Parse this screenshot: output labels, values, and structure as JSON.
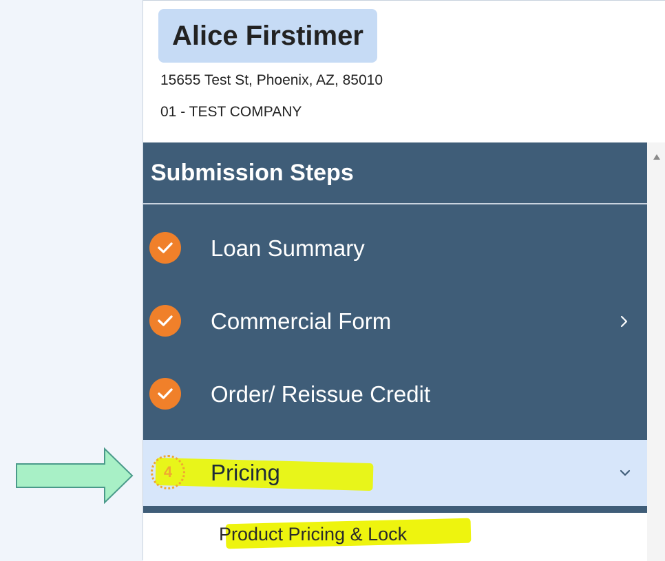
{
  "borrower": {
    "name": "Alice Firstimer",
    "address": "15655 Test St, Phoenix, AZ, 85010",
    "company": "01 - TEST COMPANY"
  },
  "nav": {
    "title": "Submission Steps",
    "steps": [
      {
        "label": "Loan Summary",
        "status": "complete"
      },
      {
        "label": "Commercial Form",
        "status": "complete"
      },
      {
        "label": "Order/ Reissue Credit",
        "status": "complete"
      },
      {
        "number": "4",
        "label": "Pricing",
        "status": "active"
      }
    ],
    "subitems": [
      {
        "label": "Product Pricing & Lock"
      }
    ]
  },
  "colors": {
    "nav_bg": "#3f5d78",
    "active_bg": "#d7e6fa",
    "check": "#f0802a",
    "highlight": "#e8f51a",
    "arrow_fill": "#a8f0c6",
    "name_bg": "#c6dbf5"
  },
  "icons": {
    "check": "check-icon",
    "chevron_right": "chevron-right-icon",
    "chevron_down": "chevron-down-icon",
    "arrow": "right-arrow-icon"
  }
}
